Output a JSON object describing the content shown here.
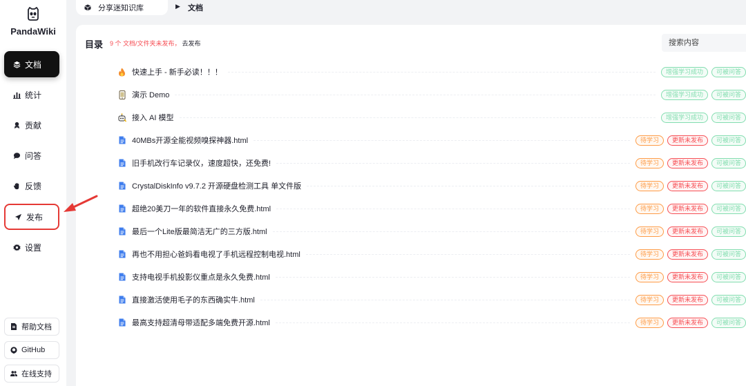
{
  "app": {
    "name": "PandaWiki"
  },
  "sidebar": {
    "items": [
      {
        "label": "文档",
        "icon": "layers-icon",
        "active": true
      },
      {
        "label": "统计",
        "icon": "bar-chart-icon"
      },
      {
        "label": "贡献",
        "icon": "contribute-icon"
      },
      {
        "label": "问答",
        "icon": "chat-icon"
      },
      {
        "label": "反馈",
        "icon": "hand-icon"
      },
      {
        "label": "发布",
        "icon": "send-icon",
        "highlighted": true
      },
      {
        "label": "设置",
        "icon": "gear-icon"
      }
    ],
    "bottom": [
      {
        "label": "帮助文档",
        "icon": "doc-icon"
      },
      {
        "label": "GitHub",
        "icon": "github-icon"
      },
      {
        "label": "在线支持",
        "icon": "people-icon"
      }
    ]
  },
  "breadcrumb": {
    "kb": "分享迷知识库",
    "current": "文档"
  },
  "main": {
    "title": "目录",
    "notice": "9 个 文档/文件夹未发布，",
    "publish_link": "去发布",
    "search_placeholder": "搜索内容",
    "docs": [
      {
        "name": "快速上手 - 新手必读！！！",
        "icon": "fire-icon",
        "tags": [
          [
            "增强学习成功",
            "green"
          ],
          [
            "可被问答",
            "green"
          ]
        ]
      },
      {
        "name": "演示 Demo",
        "icon": "phone-icon",
        "tags": [
          [
            "增强学习成功",
            "green"
          ],
          [
            "可被问答",
            "green"
          ]
        ]
      },
      {
        "name": "接入 AI 模型",
        "icon": "robot-icon",
        "tags": [
          [
            "增强学习成功",
            "green"
          ],
          [
            "可被问答",
            "green"
          ]
        ]
      },
      {
        "name": "40MBs开源全能视频嗅探神器.html",
        "icon": "file-icon",
        "tags": [
          [
            "待学习",
            "orange"
          ],
          [
            "更新未发布",
            "red"
          ],
          [
            "可被问答",
            "green"
          ]
        ]
      },
      {
        "name": "旧手机改行车记录仪，速度超快，还免费!",
        "icon": "file-icon",
        "tags": [
          [
            "待学习",
            "orange"
          ],
          [
            "更新未发布",
            "red"
          ],
          [
            "可被问答",
            "green"
          ]
        ]
      },
      {
        "name": "CrystalDiskInfo v9.7.2 开源硬盘检测工具 单文件版",
        "icon": "file-icon",
        "tags": [
          [
            "待学习",
            "orange"
          ],
          [
            "更新未发布",
            "red"
          ],
          [
            "可被问答",
            "green"
          ]
        ]
      },
      {
        "name": "超绝20美刀一年的软件直接永久免费.html",
        "icon": "file-icon",
        "tags": [
          [
            "待学习",
            "orange"
          ],
          [
            "更新未发布",
            "red"
          ],
          [
            "可被问答",
            "green"
          ]
        ]
      },
      {
        "name": "最后一个Lite版最简洁无广的三方版.html",
        "icon": "file-icon",
        "tags": [
          [
            "待学习",
            "orange"
          ],
          [
            "更新未发布",
            "red"
          ],
          [
            "可被问答",
            "green"
          ]
        ]
      },
      {
        "name": "再也不用担心爸妈看电视了手机远程控制电视.html",
        "icon": "file-icon",
        "tags": [
          [
            "待学习",
            "orange"
          ],
          [
            "更新未发布",
            "red"
          ],
          [
            "可被问答",
            "green"
          ]
        ]
      },
      {
        "name": "支持电视手机投影仪重点是永久免费.html",
        "icon": "file-icon",
        "tags": [
          [
            "待学习",
            "orange"
          ],
          [
            "更新未发布",
            "red"
          ],
          [
            "可被问答",
            "green"
          ]
        ]
      },
      {
        "name": "直接激活使用毛子的东西确实牛.html",
        "icon": "file-icon",
        "tags": [
          [
            "待学习",
            "orange"
          ],
          [
            "更新未发布",
            "red"
          ],
          [
            "可被问答",
            "green"
          ]
        ]
      },
      {
        "name": "最高支持超清母带适配多端免费开源.html",
        "icon": "file-icon",
        "tags": [
          [
            "待学习",
            "orange"
          ],
          [
            "更新未发布",
            "red"
          ],
          [
            "可被问答",
            "green"
          ]
        ]
      }
    ]
  },
  "colors": {
    "accent": "#111111",
    "highlight": "#e53935",
    "danger": "#f64e54",
    "warning": "#fe9b46",
    "success": "#82ddaf",
    "file_icon": "#3f7ded"
  }
}
